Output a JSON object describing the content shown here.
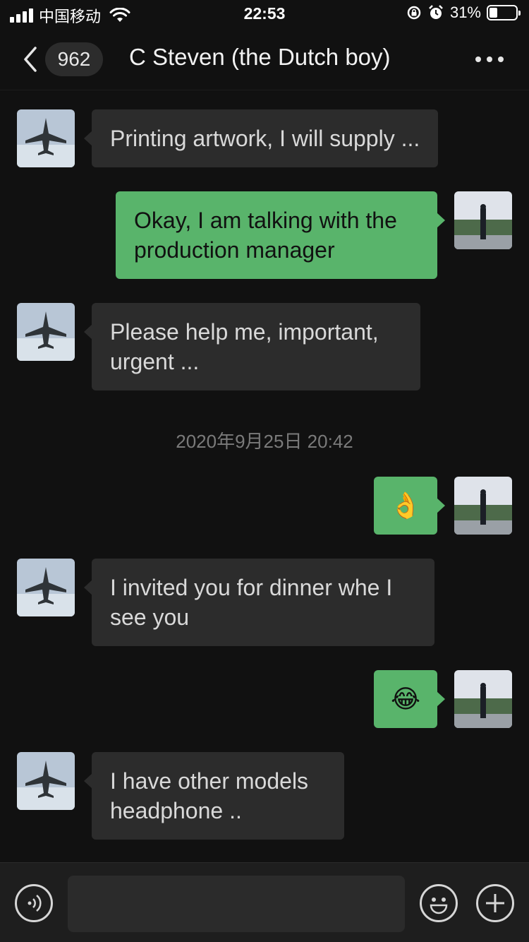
{
  "status_bar": {
    "carrier": "中国移动",
    "time": "22:53",
    "battery_percent": "31%",
    "battery_level": 0.31
  },
  "nav": {
    "unread_count": "962",
    "title": "C Steven (the Dutch boy)"
  },
  "messages": [
    {
      "side": "in",
      "text": "Printing artwork, I will supply ..."
    },
    {
      "side": "out",
      "text": "Okay, I am talking with the production manager"
    },
    {
      "side": "in",
      "text": "Please help me, important, urgent ..."
    },
    {
      "type": "timestamp",
      "text": "2020年9月25日 20:42"
    },
    {
      "side": "out",
      "text": "👌",
      "emoji_name": "ok-hand"
    },
    {
      "side": "in",
      "text": "I invited you for dinner whe I see you"
    },
    {
      "side": "out",
      "text": "😂",
      "emoji_name": "laughing-crying"
    },
    {
      "side": "in",
      "text": "I have other models headphone .."
    }
  ],
  "input": {
    "placeholder": ""
  },
  "colors": {
    "background": "#111111",
    "incoming_bubble": "#2c2c2c",
    "outgoing_bubble": "#59b46b",
    "timestamp_text": "#7a7a7a"
  }
}
